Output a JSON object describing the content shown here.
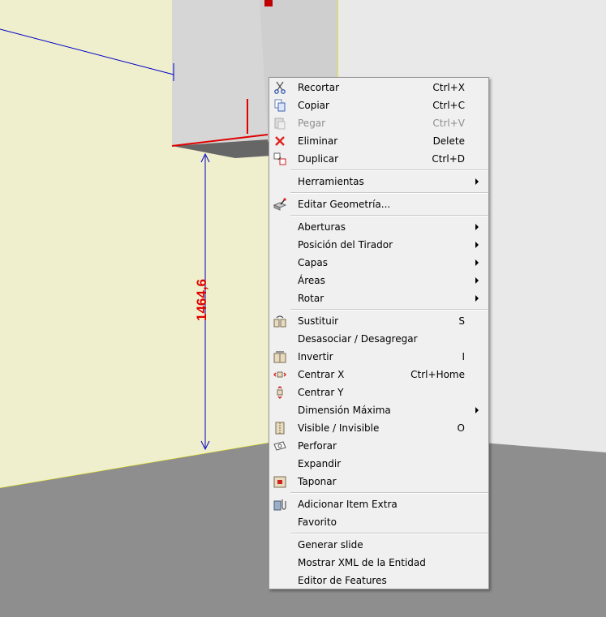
{
  "viewport": {
    "dimension_label": "1464,6",
    "colors": {
      "wall_left": "#f0efcd",
      "wall_right": "#e9e9e9",
      "floor": "#8e8e8e",
      "cabinet": "#d6d6d6",
      "dimension": "#e00000",
      "guide": "#0000c8"
    }
  },
  "menu": {
    "items": [
      {
        "label": "Recortar",
        "shortcut": "Ctrl+X",
        "icon": "scissors-icon"
      },
      {
        "label": "Copiar",
        "shortcut": "Ctrl+C",
        "icon": "copy-icon"
      },
      {
        "label": "Pegar",
        "shortcut": "Ctrl+V",
        "icon": "paste-icon",
        "disabled": true
      },
      {
        "label": "Eliminar",
        "shortcut": "Delete",
        "icon": "delete-x-icon"
      },
      {
        "label": "Duplicar",
        "shortcut": "Ctrl+D",
        "icon": "duplicate-icon"
      },
      {
        "label": "Herramientas",
        "submenu": true
      },
      {
        "label": "Editar Geometría...",
        "icon": "edit-geometry-icon"
      },
      {
        "label": "Aberturas",
        "submenu": true
      },
      {
        "label": "Posición del Tirador",
        "submenu": true
      },
      {
        "label": "Capas",
        "submenu": true
      },
      {
        "label": "Áreas",
        "submenu": true
      },
      {
        "label": "Rotar",
        "submenu": true
      },
      {
        "label": "Sustituir",
        "shortcut": "S",
        "icon": "replace-icon"
      },
      {
        "label": "Desasociar / Desagregar"
      },
      {
        "label": "Invertir",
        "shortcut": "I",
        "icon": "invert-icon"
      },
      {
        "label": "Centrar X",
        "shortcut": "Ctrl+Home",
        "icon": "center-x-icon"
      },
      {
        "label": "Centrar Y",
        "icon": "center-y-icon"
      },
      {
        "label": "Dimensión Máxima",
        "submenu": true
      },
      {
        "label": "Visible / Invisible",
        "shortcut": "O",
        "icon": "visibility-icon"
      },
      {
        "label": "Perforar",
        "icon": "drill-icon"
      },
      {
        "label": "Expandir"
      },
      {
        "label": "Taponar",
        "icon": "plug-icon"
      },
      {
        "label": "Adicionar Item Extra",
        "icon": "extra-item-icon"
      },
      {
        "label": "Favorito"
      },
      {
        "label": "Generar slide"
      },
      {
        "label": "Mostrar XML de la Entidad"
      },
      {
        "label": "Editor de Features"
      }
    ]
  }
}
